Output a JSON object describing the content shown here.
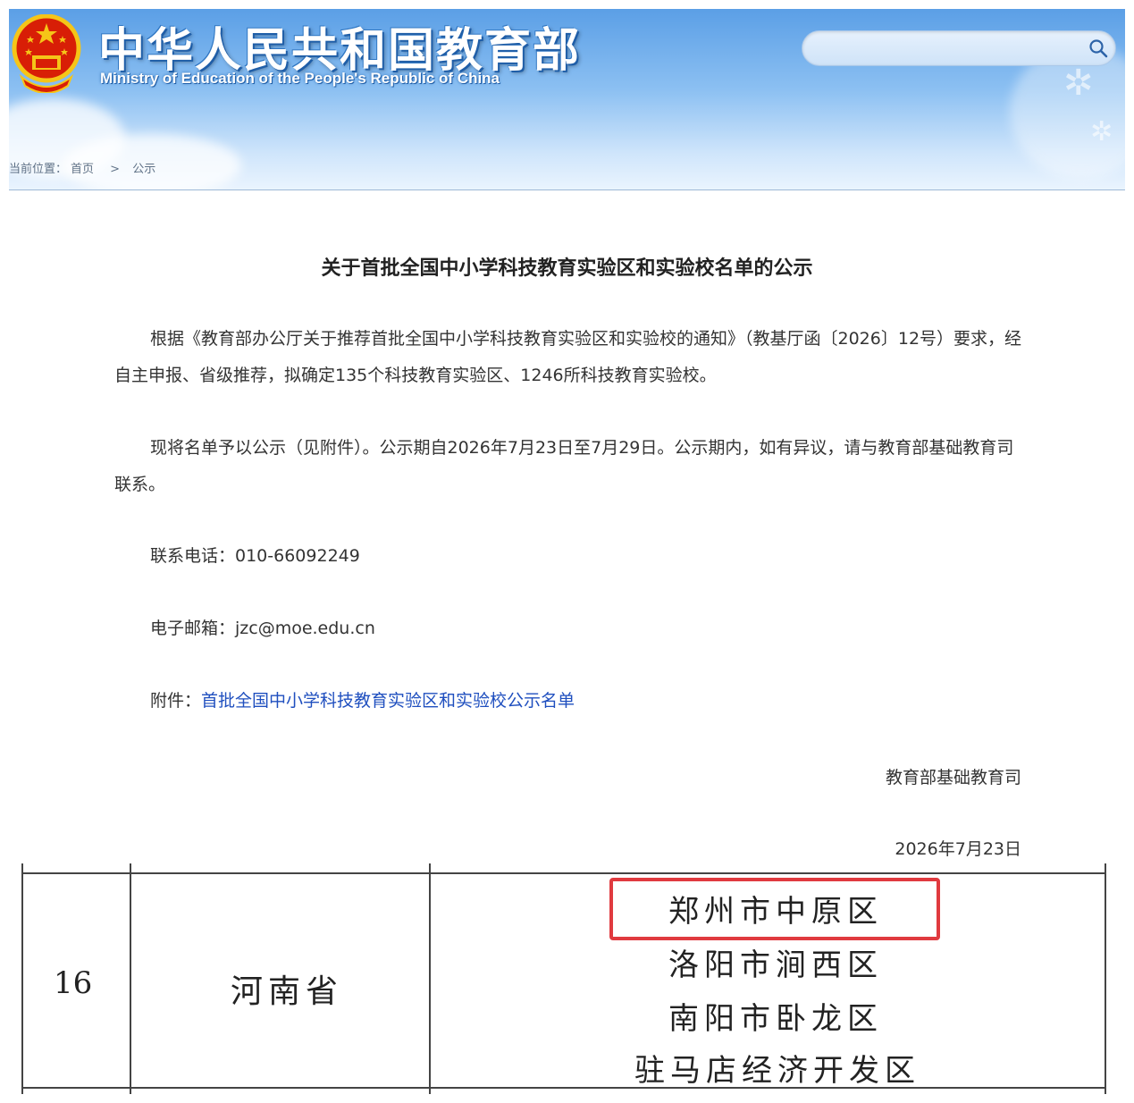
{
  "header": {
    "site_name_cn": "中华人民共和国教育部",
    "site_name_en": "Ministry of Education of the People's Republic of China",
    "search": {
      "placeholder": "",
      "value": "",
      "icon": "search-icon"
    }
  },
  "breadcrumb": {
    "label": "当前位置：",
    "home": "首页",
    "separator": ">",
    "current": "公示"
  },
  "article": {
    "title": "关于首批全国中小学科技教育实验区和实验校名单的公示",
    "para1": "根据《教育部办公厅关于推荐首批全国中小学科技教育实验区和实验校的通知》（教基厅函〔2026〕12号）要求，经自主申报、省级推荐，拟确定135个科技教育实验区、1246所科技教育实验校。",
    "para2": "现将名单予以公示（见附件）。公示期自2026年7月23日至7月29日。公示期内，如有异议，请与教育部基础教育司联系。",
    "phone": "联系电话：010-66092249",
    "email": "电子邮箱：jzc@moe.edu.cn",
    "attachment_label": "附件：",
    "attachment_link": "首批全国中小学科技教育实验区和实验校公示名单",
    "signature": "教育部基础教育司",
    "date": "2026年7月23日"
  },
  "table": {
    "row_number": "16",
    "province": "河南省",
    "districts": [
      "郑州市中原区",
      "洛阳市涧西区",
      "南阳市卧龙区",
      "驻马店经济开发区"
    ]
  },
  "colors": {
    "highlight": "#e03a3f",
    "link": "#1f4fbf",
    "banner": "#5b9fe6"
  }
}
